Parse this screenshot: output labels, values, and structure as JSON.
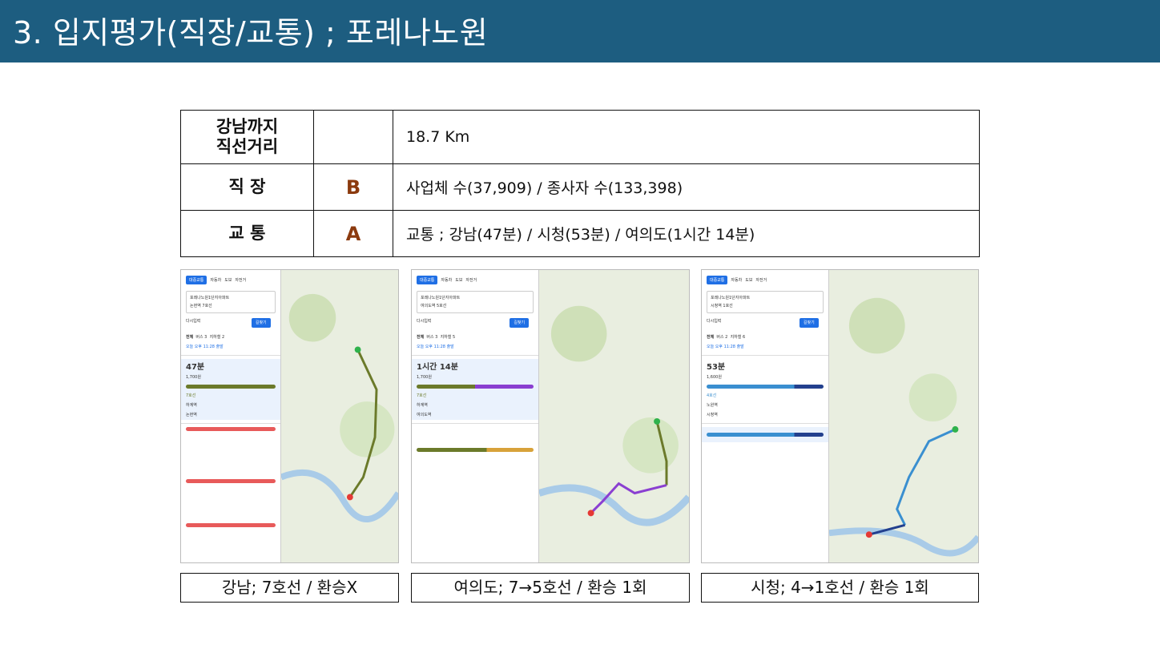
{
  "header": {
    "title": "3. 입지평가(직장/교통) ; 포레나노원"
  },
  "table": {
    "rows": [
      {
        "label": "강남까지\n직선거리",
        "grade": "",
        "value": "18.7 Km"
      },
      {
        "label": "직 장",
        "grade": "B",
        "value": "사업체 수(37,909) / 종사자 수(133,398)"
      },
      {
        "label": "교 통",
        "grade": "A",
        "value": "교통 ; 강남(47분) / 시청(53분) / 여의도(1시간 14분)"
      }
    ]
  },
  "panels": [
    {
      "tabs": [
        "대중교통",
        "자동차",
        "도보",
        "자전거"
      ],
      "from": "포레나노원1단지아파트",
      "to": "논현역 7호선",
      "reset": "다시입력",
      "go": "길찾기",
      "filter": [
        "전체",
        "버스 3",
        "지하철 2"
      ],
      "depart": "오늘 오후 11:28 출발",
      "time": "47분",
      "fare": "1,700원",
      "line": "7호선",
      "stop": "하계역",
      "end": "논현역",
      "caption": "강남; 7호선 / 환승X",
      "colors": {
        "route": "#6b7a2a"
      }
    },
    {
      "tabs": [
        "대중교통",
        "자동차",
        "도보",
        "자전거"
      ],
      "from": "포레나노원1단지아파트",
      "to": "여의도역 5호선",
      "reset": "다시입력",
      "go": "길찾기",
      "filter": [
        "전체",
        "버스 3",
        "지하철 5"
      ],
      "depart": "오늘 오후 11:28 출발",
      "time": "1시간 14분",
      "fare": "1,700원",
      "line": "7호선",
      "stop": "하계역",
      "end": "여의도역",
      "caption": "여의도; 7→5호선 / 환승 1회",
      "colors": {
        "route": "#8a3fd1"
      }
    },
    {
      "tabs": [
        "대중교통",
        "자동차",
        "도보",
        "자전거"
      ],
      "from": "포레나노원1단지아파트",
      "to": "시청역 1호선",
      "reset": "다시입력",
      "go": "길찾기",
      "filter": [
        "전체",
        "버스 2",
        "지하철 6"
      ],
      "depart": "오늘 오후 11:28 출발",
      "time": "53분",
      "fare": "1,600원",
      "line": "4호선",
      "stop": "노원역",
      "end": "시청역",
      "caption": "시청; 4→1호선 / 환승 1회",
      "colors": {
        "route": "#3a8fd0"
      }
    }
  ]
}
